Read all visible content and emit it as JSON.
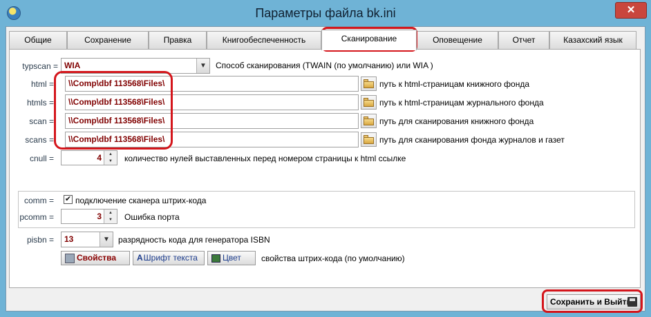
{
  "window": {
    "title": "Параметры файла bk.ini",
    "close_label": "✕"
  },
  "tabs": [
    {
      "label": "Общие"
    },
    {
      "label": "Сохранение"
    },
    {
      "label": "Правка"
    },
    {
      "label": "Книгообеспеченность"
    },
    {
      "label": "Сканирование",
      "active": true
    },
    {
      "label": "Оповещение"
    },
    {
      "label": "Отчет"
    },
    {
      "label": "Казахский язык"
    }
  ],
  "typscan": {
    "label": "typscan =",
    "value": "WIA",
    "desc": "Способ сканирования (TWAIN (по умолчанию) или WIA )"
  },
  "paths": [
    {
      "label": "html =",
      "value": "\\\\Comp\\dbf 113568\\Files\\",
      "desc": "путь к html-страницам книжного фонда"
    },
    {
      "label": "htmls =",
      "value": "\\\\Comp\\dbf 113568\\Files\\",
      "desc": "путь к html-страницам журнального фонда"
    },
    {
      "label": "scan =",
      "value": "\\\\Comp\\dbf 113568\\Files\\",
      "desc": "путь для сканирования книжного фонда"
    },
    {
      "label": "scans =",
      "value": "\\\\Comp\\dbf 113568\\Files\\",
      "desc": "путь для сканирования фонда журналов и газет"
    }
  ],
  "cnull": {
    "label": "cnull =",
    "value": "4",
    "desc": "количество нулей выставленных перед номером страницы к html ссылке"
  },
  "comm": {
    "label": "comm =",
    "checked_mark": "✔",
    "desc": "подключение сканера штрих-кода"
  },
  "pcomm": {
    "label": "pcomm =",
    "value": "3",
    "desc": "Ошибка порта"
  },
  "pisbn": {
    "label": "pisbn =",
    "value": "13",
    "desc": "разрядность кода для генератора ISBN"
  },
  "barcode_buttons": {
    "props_label": "Свойства",
    "font_label": "Шрифт текста",
    "color_label": "Цвет",
    "desc": "свойства штрих-кода (по умолчанию)"
  },
  "footer": {
    "save_exit_label": "Сохранить и Выйти"
  },
  "colors": {
    "titlebar": "#6fb3d6",
    "value_text": "#800000",
    "annotation": "#d4151b"
  }
}
